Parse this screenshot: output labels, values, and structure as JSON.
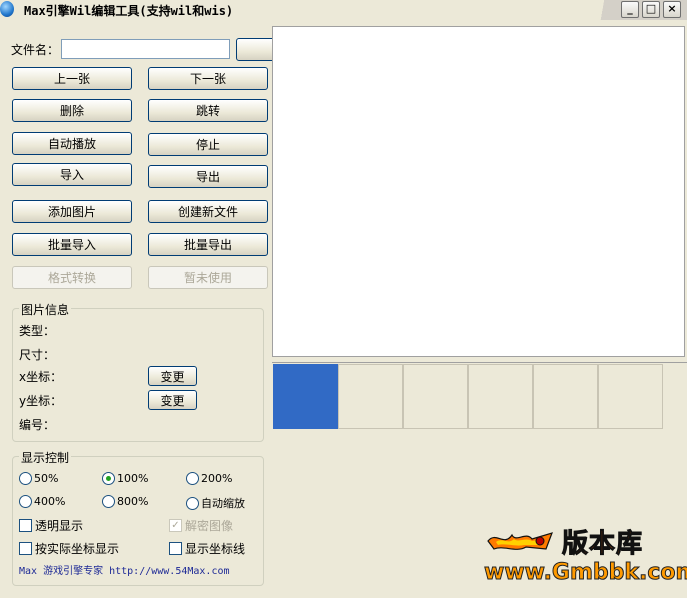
{
  "window": {
    "title": "Max引擎Wil编辑工具(支持wil和wis)",
    "minimize": "_",
    "maximize": "□",
    "close": "×"
  },
  "file": {
    "label": "文件名：",
    "value": "",
    "browse_label": "..."
  },
  "buttons": {
    "prev": "上一张",
    "next": "下一张",
    "delete": "删除",
    "jump": "跳转",
    "autoplay": "自动播放",
    "stop": "停止",
    "import": "导入",
    "export": "导出",
    "add_image": "添加图片",
    "create_file": "创建新文件",
    "batch_import": "批量导入",
    "batch_export": "批量导出",
    "format_convert": "格式转换",
    "not_used": "暂未使用"
  },
  "image_info": {
    "title": "图片信息",
    "type_label": "类型：",
    "size_label": "尺寸：",
    "x_label": "x坐标：",
    "y_label": "y坐标：",
    "id_label": "编号：",
    "change_x": "变更",
    "change_y": "变更"
  },
  "display": {
    "title": "显示控制",
    "zoom_options": [
      "50%",
      "100%",
      "200%",
      "400%",
      "800%",
      "自动缩放"
    ],
    "zoom_selected": "100%",
    "transparent": "透明显示",
    "transparent_checked": false,
    "decrypt": "解密图像",
    "decrypt_checked": true,
    "decrypt_enabled": false,
    "actual_coords": "按实际坐标显示",
    "actual_coords_checked": false,
    "show_coord_lines": "显示坐标线",
    "show_coord_lines_checked": false
  },
  "footer": {
    "text": "Max 游戏引擎专家 http://www.54Max.com"
  },
  "thumbnails": {
    "count": 6,
    "selected_index": 0
  },
  "watermark": {
    "logo_text": "版本库",
    "url": "www.Gmbbk.com"
  },
  "colors": {
    "selection": "#316ac5",
    "footer_text": "#1e2a96",
    "logo_orange": "#ff6a00"
  }
}
